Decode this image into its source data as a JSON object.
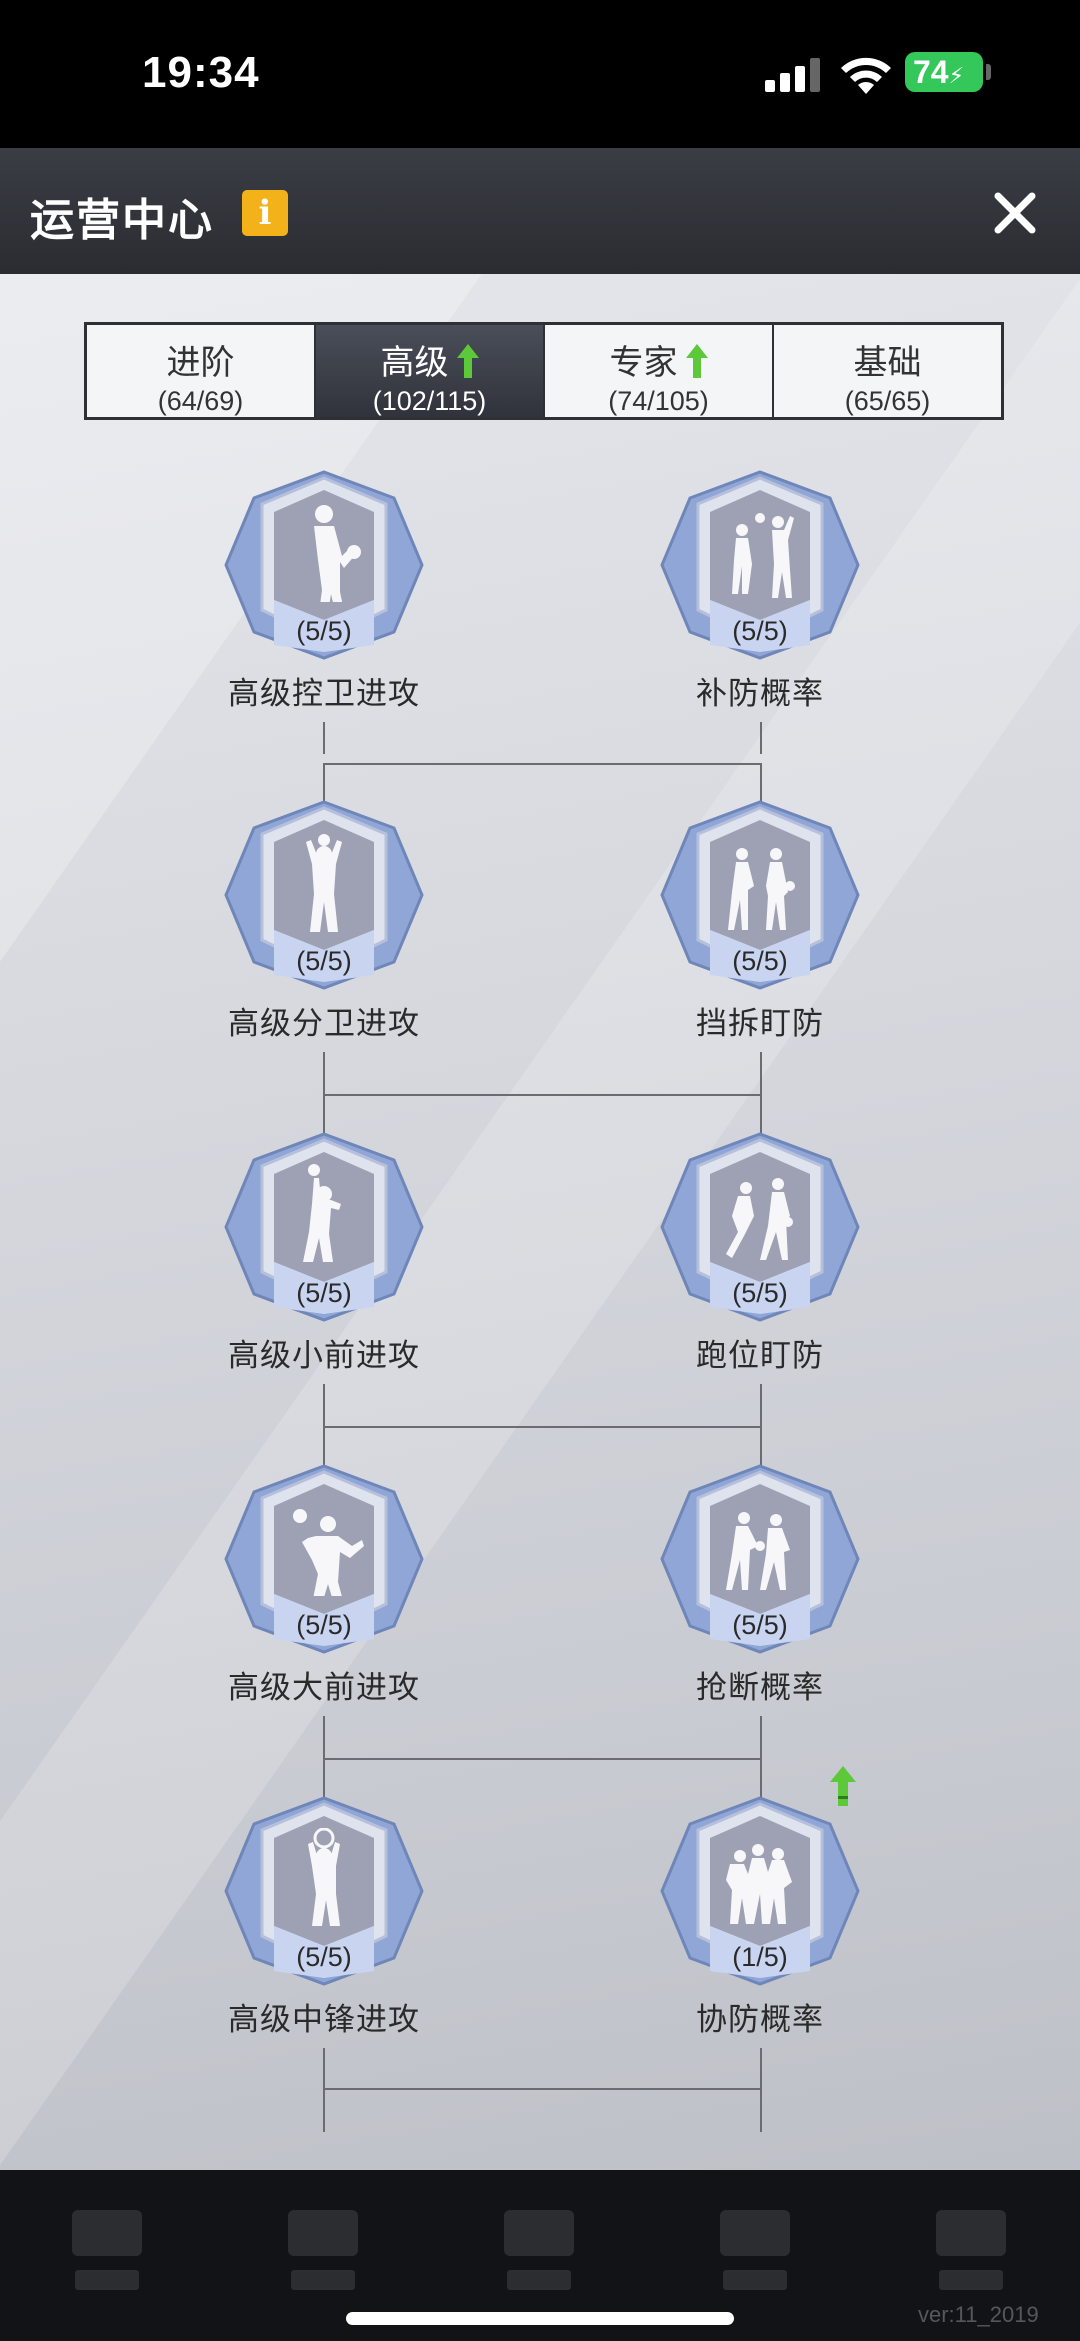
{
  "status_bar": {
    "time": "19:34",
    "battery": "74"
  },
  "header": {
    "title": "运营中心",
    "info_icon": "i"
  },
  "tabs": [
    {
      "name": "进阶",
      "count": "(64/69)",
      "active": false,
      "upgrade": false
    },
    {
      "name": "高级",
      "count": "(102/115)",
      "active": true,
      "upgrade": true
    },
    {
      "name": "专家",
      "count": "(74/105)",
      "active": false,
      "upgrade": true
    },
    {
      "name": "基础",
      "count": "(65/65)",
      "active": false,
      "upgrade": false
    }
  ],
  "skills": [
    {
      "label": "高级控卫进攻",
      "progress": "(5/5)",
      "icon": "dribbler-icon"
    },
    {
      "label": "补防概率",
      "progress": "(5/5)",
      "icon": "help-defense-icon"
    },
    {
      "label": "高级分卫进攻",
      "progress": "(5/5)",
      "icon": "shooter-icon"
    },
    {
      "label": "挡拆盯防",
      "progress": "(5/5)",
      "icon": "pick-roll-defense-icon"
    },
    {
      "label": "高级小前进攻",
      "progress": "(5/5)",
      "icon": "small-forward-icon"
    },
    {
      "label": "跑位盯防",
      "progress": "(5/5)",
      "icon": "off-ball-defense-icon"
    },
    {
      "label": "高级大前进攻",
      "progress": "(5/5)",
      "icon": "power-forward-icon"
    },
    {
      "label": "抢断概率",
      "progress": "(5/5)",
      "icon": "steal-icon"
    },
    {
      "label": "高级中锋进攻",
      "progress": "(5/5)",
      "icon": "center-dunk-icon"
    },
    {
      "label": "协防概率",
      "progress": "(1/5)",
      "icon": "team-defense-icon",
      "upgrade": true
    }
  ],
  "footer": {
    "version": "ver:11_2019"
  },
  "colors": {
    "accent_info": "#f3b21a",
    "upgrade_green": "#5cc83a",
    "header_bg": "#2f3137",
    "tab_active": "#3a3d46"
  }
}
